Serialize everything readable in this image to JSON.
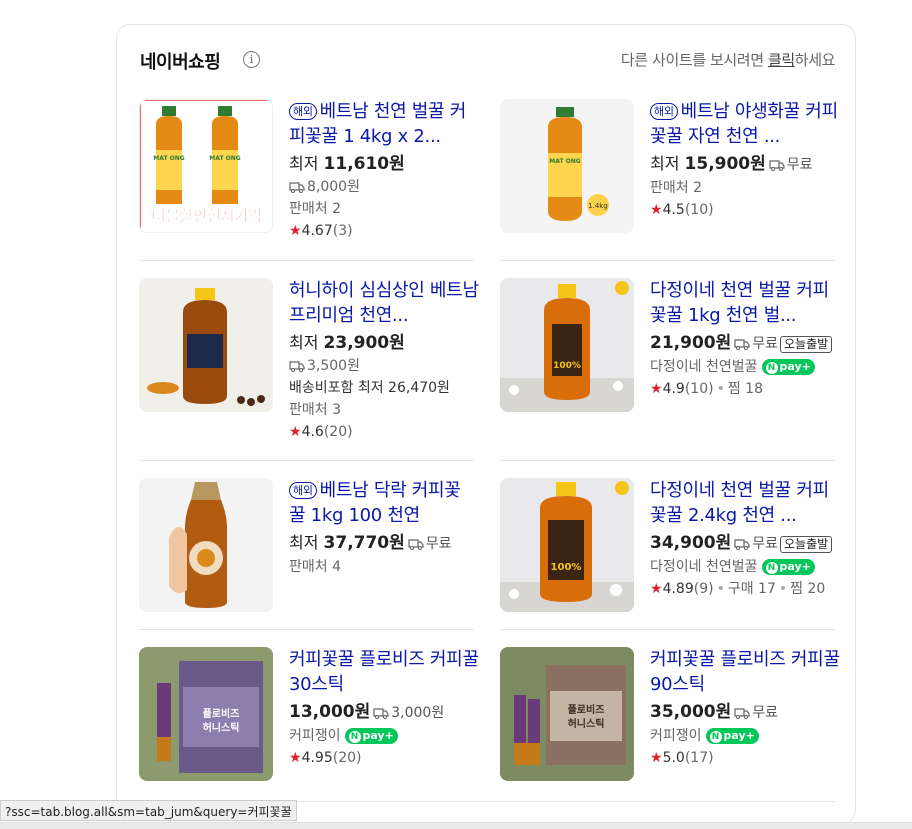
{
  "header": {
    "title": "네이버쇼핑",
    "info_icon": "i",
    "notice_prefix": "다른 사이트를 보시려면 ",
    "notice_link": "클릭",
    "notice_suffix": "하세요"
  },
  "items": [
    {
      "badge": "해외",
      "title": "베트남 천연 벌꿀 커피꽃꿀 1 4kg x 2...",
      "price_prefix": "최저 ",
      "price": "11,610원",
      "shipping": "8,000원",
      "sellers": "판매처 2",
      "rating": "4.67",
      "reviews": "(3)",
      "thumb_text": "더블할인현지가격",
      "thumb_label": "MAT ONG"
    },
    {
      "badge": "해외",
      "title": "베트남 야생화꿀 커피꽃꿀 자연 천연 ...",
      "price_prefix": "최저 ",
      "price": "15,900원",
      "shipping": "무료",
      "sellers": "판매처 2",
      "rating": "4.5",
      "reviews": "(10)",
      "thumb_label": "MAT ONG",
      "thumb_weight": "1.4kg"
    },
    {
      "title": "허니하이 심심상인 베트남 프리미엄 천연...",
      "price_prefix": "최저 ",
      "price": "23,900원",
      "shipping": "3,500원",
      "extra": "배송비포함 최저 26,470원",
      "sellers": "판매처 3",
      "rating": "4.6",
      "reviews": "(20)"
    },
    {
      "title": "다정이네 천연 벌꿀 커피꽃꿀 1kg 천연 벌...",
      "price": "21,900원",
      "shipping": "무료",
      "tag": "오늘출발",
      "seller_name": "다정이네 천연벌꿀",
      "npay": "pay",
      "rating": "4.9",
      "reviews": "(10)",
      "wish": "찜 18",
      "thumb_label": "100%"
    },
    {
      "badge": "해외",
      "title": "베트남 닥락 커피꽃 꿀 1kg 100 천연",
      "price_prefix": "최저 ",
      "price": "37,770원",
      "shipping": "무료",
      "sellers": "판매처 4"
    },
    {
      "title": "다정이네 천연 벌꿀 커피꽃꿀 2.4kg 천연 ...",
      "price": "34,900원",
      "shipping": "무료",
      "tag": "오늘출발",
      "seller_name": "다정이네 천연벌꿀",
      "npay": "pay",
      "rating": "4.89",
      "reviews": "(9)",
      "purchases": "구매 17",
      "wish": "찜 20",
      "thumb_label": "100%"
    },
    {
      "title": "커피꽃꿀 플로비즈 커피꿀 30스틱",
      "price": "13,000원",
      "shipping": "3,000원",
      "seller_name": "커피쟁이",
      "npay": "pay",
      "rating": "4.95",
      "reviews": "(20)",
      "thumb_label": "플로비즈 허니스틱"
    },
    {
      "title": "커피꽃꿀 플로비즈 커피꿀 90스틱",
      "price": "35,000원",
      "shipping": "무료",
      "seller_name": "커피쟁이",
      "npay": "pay",
      "rating": "5.0",
      "reviews": "(17)",
      "thumb_label": "플로비즈 허니스틱"
    }
  ],
  "status_url": "?ssc=tab.blog.all&sm=tab_jum&query=커피꽃꿀",
  "colors": {
    "title_link": "#0b18a8",
    "star": "#e0212e",
    "npay_green": "#03c75a",
    "border": "#e3e5e8"
  }
}
